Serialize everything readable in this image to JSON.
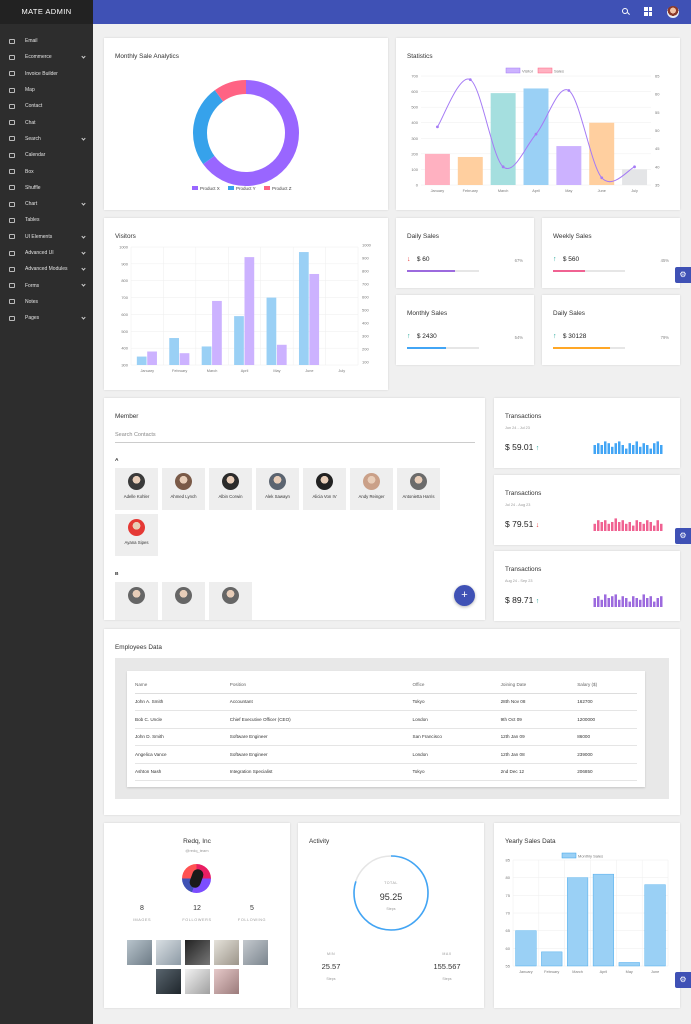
{
  "app": {
    "brand": "MATE ADMIN"
  },
  "sidebar": {
    "items": [
      {
        "label": "Email",
        "has_children": false
      },
      {
        "label": "Ecommerce",
        "has_children": true
      },
      {
        "label": "Invoice Builder",
        "has_children": false
      },
      {
        "label": "Map",
        "has_children": false
      },
      {
        "label": "Contact",
        "has_children": false
      },
      {
        "label": "Chat",
        "has_children": false
      },
      {
        "label": "Search",
        "has_children": true
      },
      {
        "label": "Calendar",
        "has_children": false
      },
      {
        "label": "Box",
        "has_children": false
      },
      {
        "label": "Shuffle",
        "has_children": false
      },
      {
        "label": "Chart",
        "has_children": true
      },
      {
        "label": "Tables",
        "has_children": false
      },
      {
        "label": "UI Elements",
        "has_children": true
      },
      {
        "label": "Advanced UI",
        "has_children": true
      },
      {
        "label": "Advanced Modules",
        "has_children": true
      },
      {
        "label": "Forms",
        "has_children": true
      },
      {
        "label": "Notes",
        "has_children": false
      },
      {
        "label": "Pages",
        "has_children": true
      }
    ]
  },
  "cards": {
    "sale_analytics": {
      "title": "Monthly Sale Analytics"
    },
    "statistics": {
      "title": "Statistics"
    },
    "visitors": {
      "title": "Visitors"
    },
    "member": {
      "title": "Member",
      "search_placeholder": "Search Contacts",
      "fab": "+"
    },
    "employees": {
      "title": "Employees Data"
    },
    "activity": {
      "title": "Activity"
    },
    "yearly": {
      "title": "Yearly Sales Data"
    }
  },
  "stats": [
    {
      "title": "Daily Sales",
      "amount": "$ 60",
      "pct": "67%",
      "progress": 67,
      "trend": "down",
      "color": "#9c6ade"
    },
    {
      "title": "Weekly Sales",
      "amount": "$ 560",
      "pct": "45%",
      "progress": 45,
      "trend": "up",
      "color": "#f06292"
    },
    {
      "title": "Monthly Sales",
      "amount": "$ 2430",
      "pct": "54%",
      "progress": 54,
      "trend": "up",
      "color": "#42a5f5"
    },
    {
      "title": "Daily Sales",
      "amount": "$ 30128",
      "pct": "79%",
      "progress": 79,
      "trend": "up",
      "color": "#ffa726"
    }
  ],
  "members": {
    "A": [
      "Adelle Kohler",
      "Ahmed Lynch",
      "Albin Corwin",
      "Alek Sawayn",
      "Alicia Von IV",
      "Andy Reinger",
      "Antonietta Harris",
      "Ayana Sipes"
    ],
    "B": [
      "",
      "",
      ""
    ],
    "labels": [
      "A",
      "B"
    ]
  },
  "transactions": [
    {
      "title": "Transactions",
      "range": "Jun 24 - Jul 23",
      "amount": "$ 59.01",
      "trend": "up",
      "color": "#42a5f5",
      "bars": [
        5,
        6,
        5,
        7,
        6,
        4,
        6,
        7,
        5,
        3,
        6,
        5,
        7,
        4,
        6,
        5,
        3,
        6,
        7,
        5
      ]
    },
    {
      "title": "Transactions",
      "range": "Jul 24 - Aug 23",
      "amount": "$ 79.51",
      "trend": "down",
      "color": "#f06292",
      "bars": [
        4,
        6,
        5,
        6,
        4,
        5,
        7,
        5,
        6,
        4,
        5,
        3,
        6,
        5,
        4,
        6,
        5,
        3,
        6,
        4
      ]
    },
    {
      "title": "Transactions",
      "range": "Aug 24 - Sep 23",
      "amount": "$ 89.71",
      "trend": "up",
      "color": "#9c6ade",
      "bars": [
        5,
        6,
        4,
        7,
        5,
        6,
        7,
        4,
        6,
        5,
        3,
        6,
        5,
        4,
        7,
        5,
        6,
        3,
        5,
        6
      ]
    }
  ],
  "employees": {
    "headers": [
      "Name",
      "Position",
      "Office",
      "Joining Date",
      "Salary ($)"
    ],
    "rows": [
      [
        "John A. Smith",
        "Accountant",
        "Tokyo",
        "28th Nov 08",
        "162700"
      ],
      [
        "Bob C. Uncle",
        "Chief Executive Officer (CEO)",
        "London",
        "9th Oct 09",
        "1200000"
      ],
      [
        "John D. Smith",
        "Software Engineer",
        "San Francisco",
        "12th Jan 09",
        "86000"
      ],
      [
        "Angelica Vance",
        "Software Engineer",
        "London",
        "12th Jan 08",
        "239000"
      ],
      [
        "Ashton Nash",
        "Integration Specialist",
        "Tokyo",
        "2nd Dec 12",
        "206850"
      ]
    ]
  },
  "profile": {
    "name": "Redq, Inc",
    "handle": "@redq_team",
    "stats": [
      {
        "value": "8",
        "label": "IMAGES"
      },
      {
        "value": "12",
        "label": "FOLLOWERS"
      },
      {
        "value": "5",
        "label": "FOLLOWING"
      }
    ]
  },
  "activity": {
    "total_label": "TOTAL",
    "total_value": "95.25",
    "total_unit": "Steps",
    "ring_progress": 0.8,
    "min_label": "MIN",
    "min_value": "25.57",
    "min_unit": "Steps",
    "max_label": "MAX",
    "max_value": "155.567",
    "max_unit": "Steps"
  },
  "chart_data": [
    {
      "type": "pie",
      "id": "sale-analytics",
      "labels": [
        "Product X",
        "Product Y",
        "Product Z"
      ],
      "values": [
        65,
        25,
        10
      ],
      "colors": [
        "#9966ff",
        "#36a2eb",
        "#ff6384"
      ]
    },
    {
      "type": "bar",
      "id": "statistics",
      "categories": [
        "January",
        "February",
        "March",
        "April",
        "May",
        "June",
        "July"
      ],
      "series": [
        {
          "name": "Sales",
          "type": "bar",
          "values": [
            200,
            180,
            590,
            620,
            250,
            400,
            100
          ],
          "color": "#ff9fc3"
        },
        {
          "name": "Visitor",
          "type": "line",
          "values": [
            51,
            64,
            40,
            49,
            61,
            37,
            40
          ],
          "color": "#a57bf5"
        }
      ],
      "bar_colors": [
        "#ffb1c1",
        "#ffcf9f",
        "#a5dfdf",
        "#9ad0f5",
        "#ccb2ff",
        "#ffcf9f",
        "#e4e5e7"
      ],
      "ylim_left": [
        0,
        700
      ],
      "yticks_left": [
        0,
        100,
        200,
        300,
        400,
        500,
        600,
        700
      ],
      "ylim_right": [
        35,
        65
      ],
      "yticks_right": [
        35,
        40,
        45,
        50,
        55,
        60,
        65
      ]
    },
    {
      "type": "bar",
      "id": "visitors",
      "categories": [
        "January",
        "February",
        "March",
        "April",
        "May",
        "June",
        "July"
      ],
      "series": [
        {
          "name": "",
          "values": [
            350,
            460,
            410,
            590,
            700,
            970,
            null
          ],
          "color": "#9ad0f5"
        },
        {
          "name": "",
          "values": [
            380,
            370,
            680,
            940,
            420,
            840,
            null
          ],
          "color": "#ccb2ff"
        }
      ],
      "ylim_left": [
        300,
        1000
      ],
      "yticks_left": [
        300,
        400,
        500,
        600,
        700,
        800,
        900,
        1000
      ],
      "yticks_right": [
        100,
        200,
        300,
        400,
        500,
        600,
        700,
        800,
        900,
        1000
      ]
    },
    {
      "type": "bar",
      "id": "yearly-sales",
      "categories": [
        "January",
        "February",
        "March",
        "April",
        "May",
        "June"
      ],
      "series": [
        {
          "name": "Monthly Sales",
          "values": [
            65,
            59,
            80,
            81,
            56,
            78
          ],
          "color": "#9ad0f5"
        }
      ],
      "ylim": [
        55,
        85
      ],
      "yticks": [
        55,
        60,
        65,
        70,
        75,
        80,
        85
      ]
    }
  ]
}
